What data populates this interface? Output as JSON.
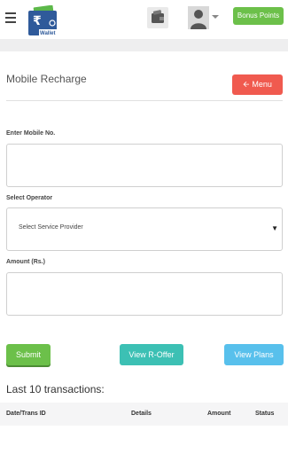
{
  "topbar": {
    "logo_text": "Wallet",
    "bonus_label": "Bonus Points"
  },
  "form": {
    "title": "Mobile Recharge",
    "menu_label": "Menu",
    "mobile_label": "Enter Mobile No.",
    "mobile_value": "",
    "operator_label": "Select Operator",
    "operator_selected": "Select Service Provider",
    "amount_label": "Amount (Rs.)",
    "amount_value": ""
  },
  "actions": {
    "submit_label": "Submit",
    "roffer_label": "View R-Offer",
    "plans_label": "View Plans"
  },
  "transactions": {
    "heading": "Last 10 transactions:",
    "columns": [
      "Date/Trans ID",
      "Details",
      "Amount",
      "Status"
    ]
  },
  "colors": {
    "bonus": "#6cc04a",
    "menu": "#f05a4f",
    "roffer": "#3cc0b4",
    "plans": "#58c0ec"
  }
}
